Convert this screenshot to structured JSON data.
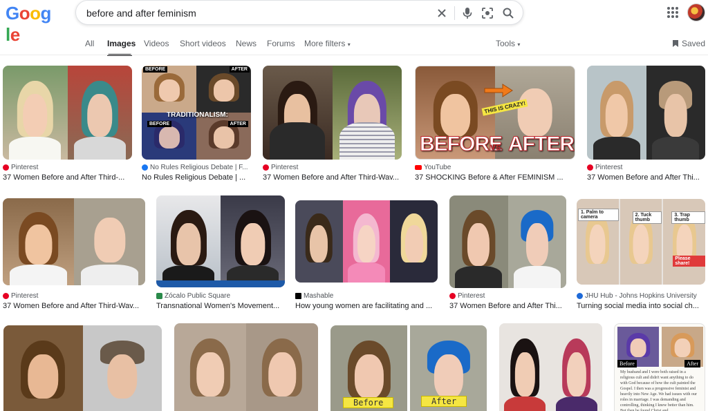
{
  "search": {
    "query": "before and after feminism"
  },
  "logo_letters": [
    "G",
    "o",
    "o",
    "g",
    "l",
    "e"
  ],
  "logo_colors": [
    "#4285f4",
    "#ea4335",
    "#fbbc05",
    "#4285f4",
    "#34a853",
    "#ea4335"
  ],
  "tabs": {
    "all": "All",
    "images": "Images",
    "videos": "Videos",
    "short_videos": "Short videos",
    "news": "News",
    "forums": "Forums",
    "more_filters": "More filters",
    "tools": "Tools",
    "saved": "Saved"
  },
  "results": [
    {
      "source": "Pinterest",
      "title": "37 Women Before and After Third-..."
    },
    {
      "source": "No Rules Religious Debate | F...",
      "title": "No Rules Religious Debate | ..."
    },
    {
      "source": "Pinterest",
      "title": "37 Women Before and After Third-Wav..."
    },
    {
      "source": "YouTube",
      "title": "37 SHOCKING Before & After FEMINISM ..."
    },
    {
      "source": "Pinterest",
      "title": "37 Women Before and After Thi..."
    },
    {
      "source": "Pinterest",
      "title": "37 Women Before and After Third-Wav..."
    },
    {
      "source": "Zócalo Public Square",
      "title": "Transnational Women's Movement..."
    },
    {
      "source": "Mashable",
      "title": "How young women are facilitating and ..."
    },
    {
      "source": "Pinterest",
      "title": "37 Women Before and After Thi..."
    },
    {
      "source": "JHU Hub - Johns Hopkins University",
      "title": "Turning social media into social ch..."
    }
  ],
  "overlays": {
    "before_upper": "BEFORE",
    "after_upper": "AFTER",
    "traditionalism": "TRADITIONALISM:",
    "before_small": "BEFORE",
    "after_small": "AFTER",
    "this_is_crazy": "THIS IS CRAZY!",
    "before_vs": "BEFORE",
    "vs": "vs",
    "after_big": "AFTER",
    "step1": "1. Palm to camera",
    "step2": "2. Tuck thumb",
    "step3": "3. Trap thumb",
    "please_share": "Please share!",
    "yellow_before": "Before",
    "yellow_after": "After",
    "serif_before": "Before",
    "serif_after": "After",
    "note_text": "My husband and I were both raised in a religious cult and didn't want anything to do with God because of how the cult painted the Gospel. I then was a progressive feminist and heavily into New Age. We had issues with our roles in marriage. I was demanding and controlling, thinking I knew better than him. But then he found Christ and..."
  }
}
